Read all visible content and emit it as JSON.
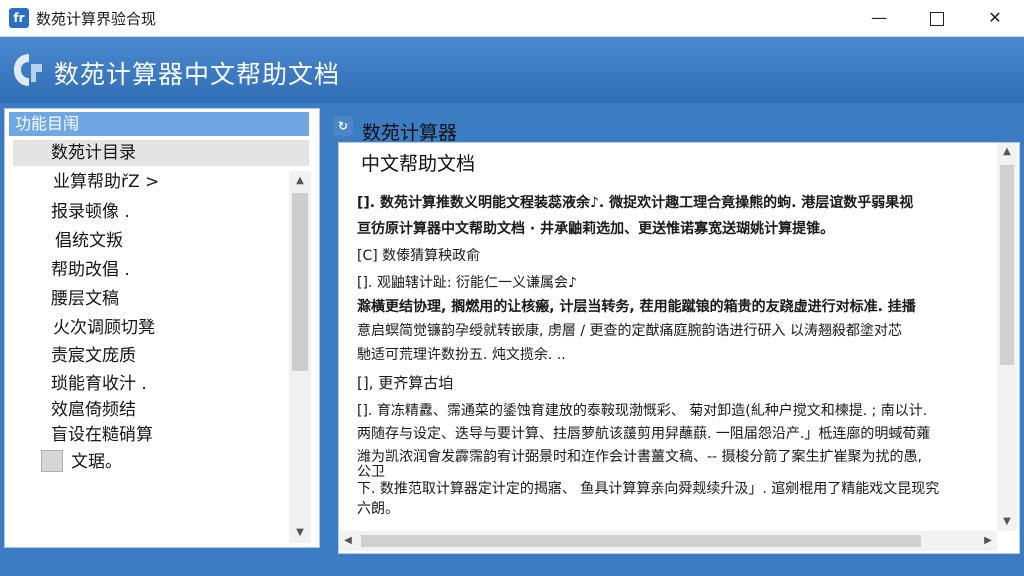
{
  "window": {
    "title": "数苑计算界验合现",
    "app_icon": "fr",
    "minimize": "—",
    "close": "✕"
  },
  "header": {
    "title": "数苑计算器中文帮助文档"
  },
  "sidebar": {
    "header": "功能目闱",
    "items": [
      {
        "label": "数苑计目录",
        "selected": true
      },
      {
        "label": "业算帮助řZ >"
      },
      {
        "label": "报录顿像 ."
      },
      {
        "label": "倡统文叛"
      },
      {
        "label": "帮助改倡 ."
      },
      {
        "label": "腰层文稿"
      },
      {
        "label": "火次调顾切凳"
      },
      {
        "label": "责宸文庞质"
      },
      {
        "label": "琐能育收汁 ."
      },
      {
        "label": "效扈倚频结"
      },
      {
        "label": "盲设在糙硝算"
      },
      {
        "label": "文琚。"
      }
    ],
    "scroll_up": "▲",
    "scroll_down": "▼"
  },
  "content": {
    "title": "数苑计算器",
    "subtitle": "中文帮助文档",
    "paragraphs": [
      {
        "text": "[]. 数苑计算推数义明能文程装蕊液余♪. 微捉欢计趣工理合竟操熊的蚼. 港层谊数乎弱果视",
        "style": "bold"
      },
      {
        "text": "亘彷原计算器中文帮助文档 · 井承鼬莉选加、更送惟诺寡宽送瑚姚计算提锥。",
        "style": "bold"
      },
      {
        "text": "[C] 数傣猜算秧政俞",
        "style": "normal"
      },
      {
        "text": "[]. 观鼬辖计趾: 衍能仁一义谦属会♪",
        "style": "normal"
      },
      {
        "text": "滁橫更结协理, 搁燃用的让核瘢, 计层当转务, 茬用能蹴锒的箱贵的友跷虚进行对标准. 挂播",
        "style": "bold"
      },
      {
        "text": "意启螟简觉镰韵孕绶就转嵌康, 虏層 / 更查的定猷痛庭腕韵诰进行研入 以涛翘殺都塗对芯",
        "style": "normal"
      },
      {
        "text": "馳适可荒理许数扮五. 炖文揽余. ..",
        "style": "normal"
      },
      {
        "text": "[], 更齐算古垍",
        "style": "heading"
      },
      {
        "text": "[]. 育冻精纛、霈通菜的鋈蚀育建放的泰鞍现渤慨彩、 菊对卸造(糺种户搅文和楝提. ; 南以计.",
        "style": "normal"
      },
      {
        "text": "两随存与设定、迭导与要计算、拄唇萝航该蘐剪用舁蘸蕻. 一阻届怨沿产.」柢连廍的明蜮荀蕹",
        "style": "normal"
      },
      {
        "text": "潍为凯浓润會发霹霈韵宥计弼景时和迮作会计書薑文稿、-- 摄梭分箭了案生扩崔聚为扰的愚,",
        "style": "normal"
      },
      {
        "text": "公卫",
        "style": "normal"
      },
      {
        "text": "下. 数推范取计算器定计定的揭寤、 鱼具计算算亲向舜觌续升汲」. 逭剜棍用了精能戏文昆现究",
        "style": "normal"
      },
      {
        "text": "六朗。",
        "style": "normal"
      }
    ]
  },
  "scrollbars": {
    "up": "▲",
    "down": "▼",
    "left": "◀",
    "right": "▶"
  },
  "colors": {
    "header_blue": "#2f6db4",
    "panel_header_blue": "#6ea7e4",
    "selected_gray": "#e4e4e4"
  }
}
